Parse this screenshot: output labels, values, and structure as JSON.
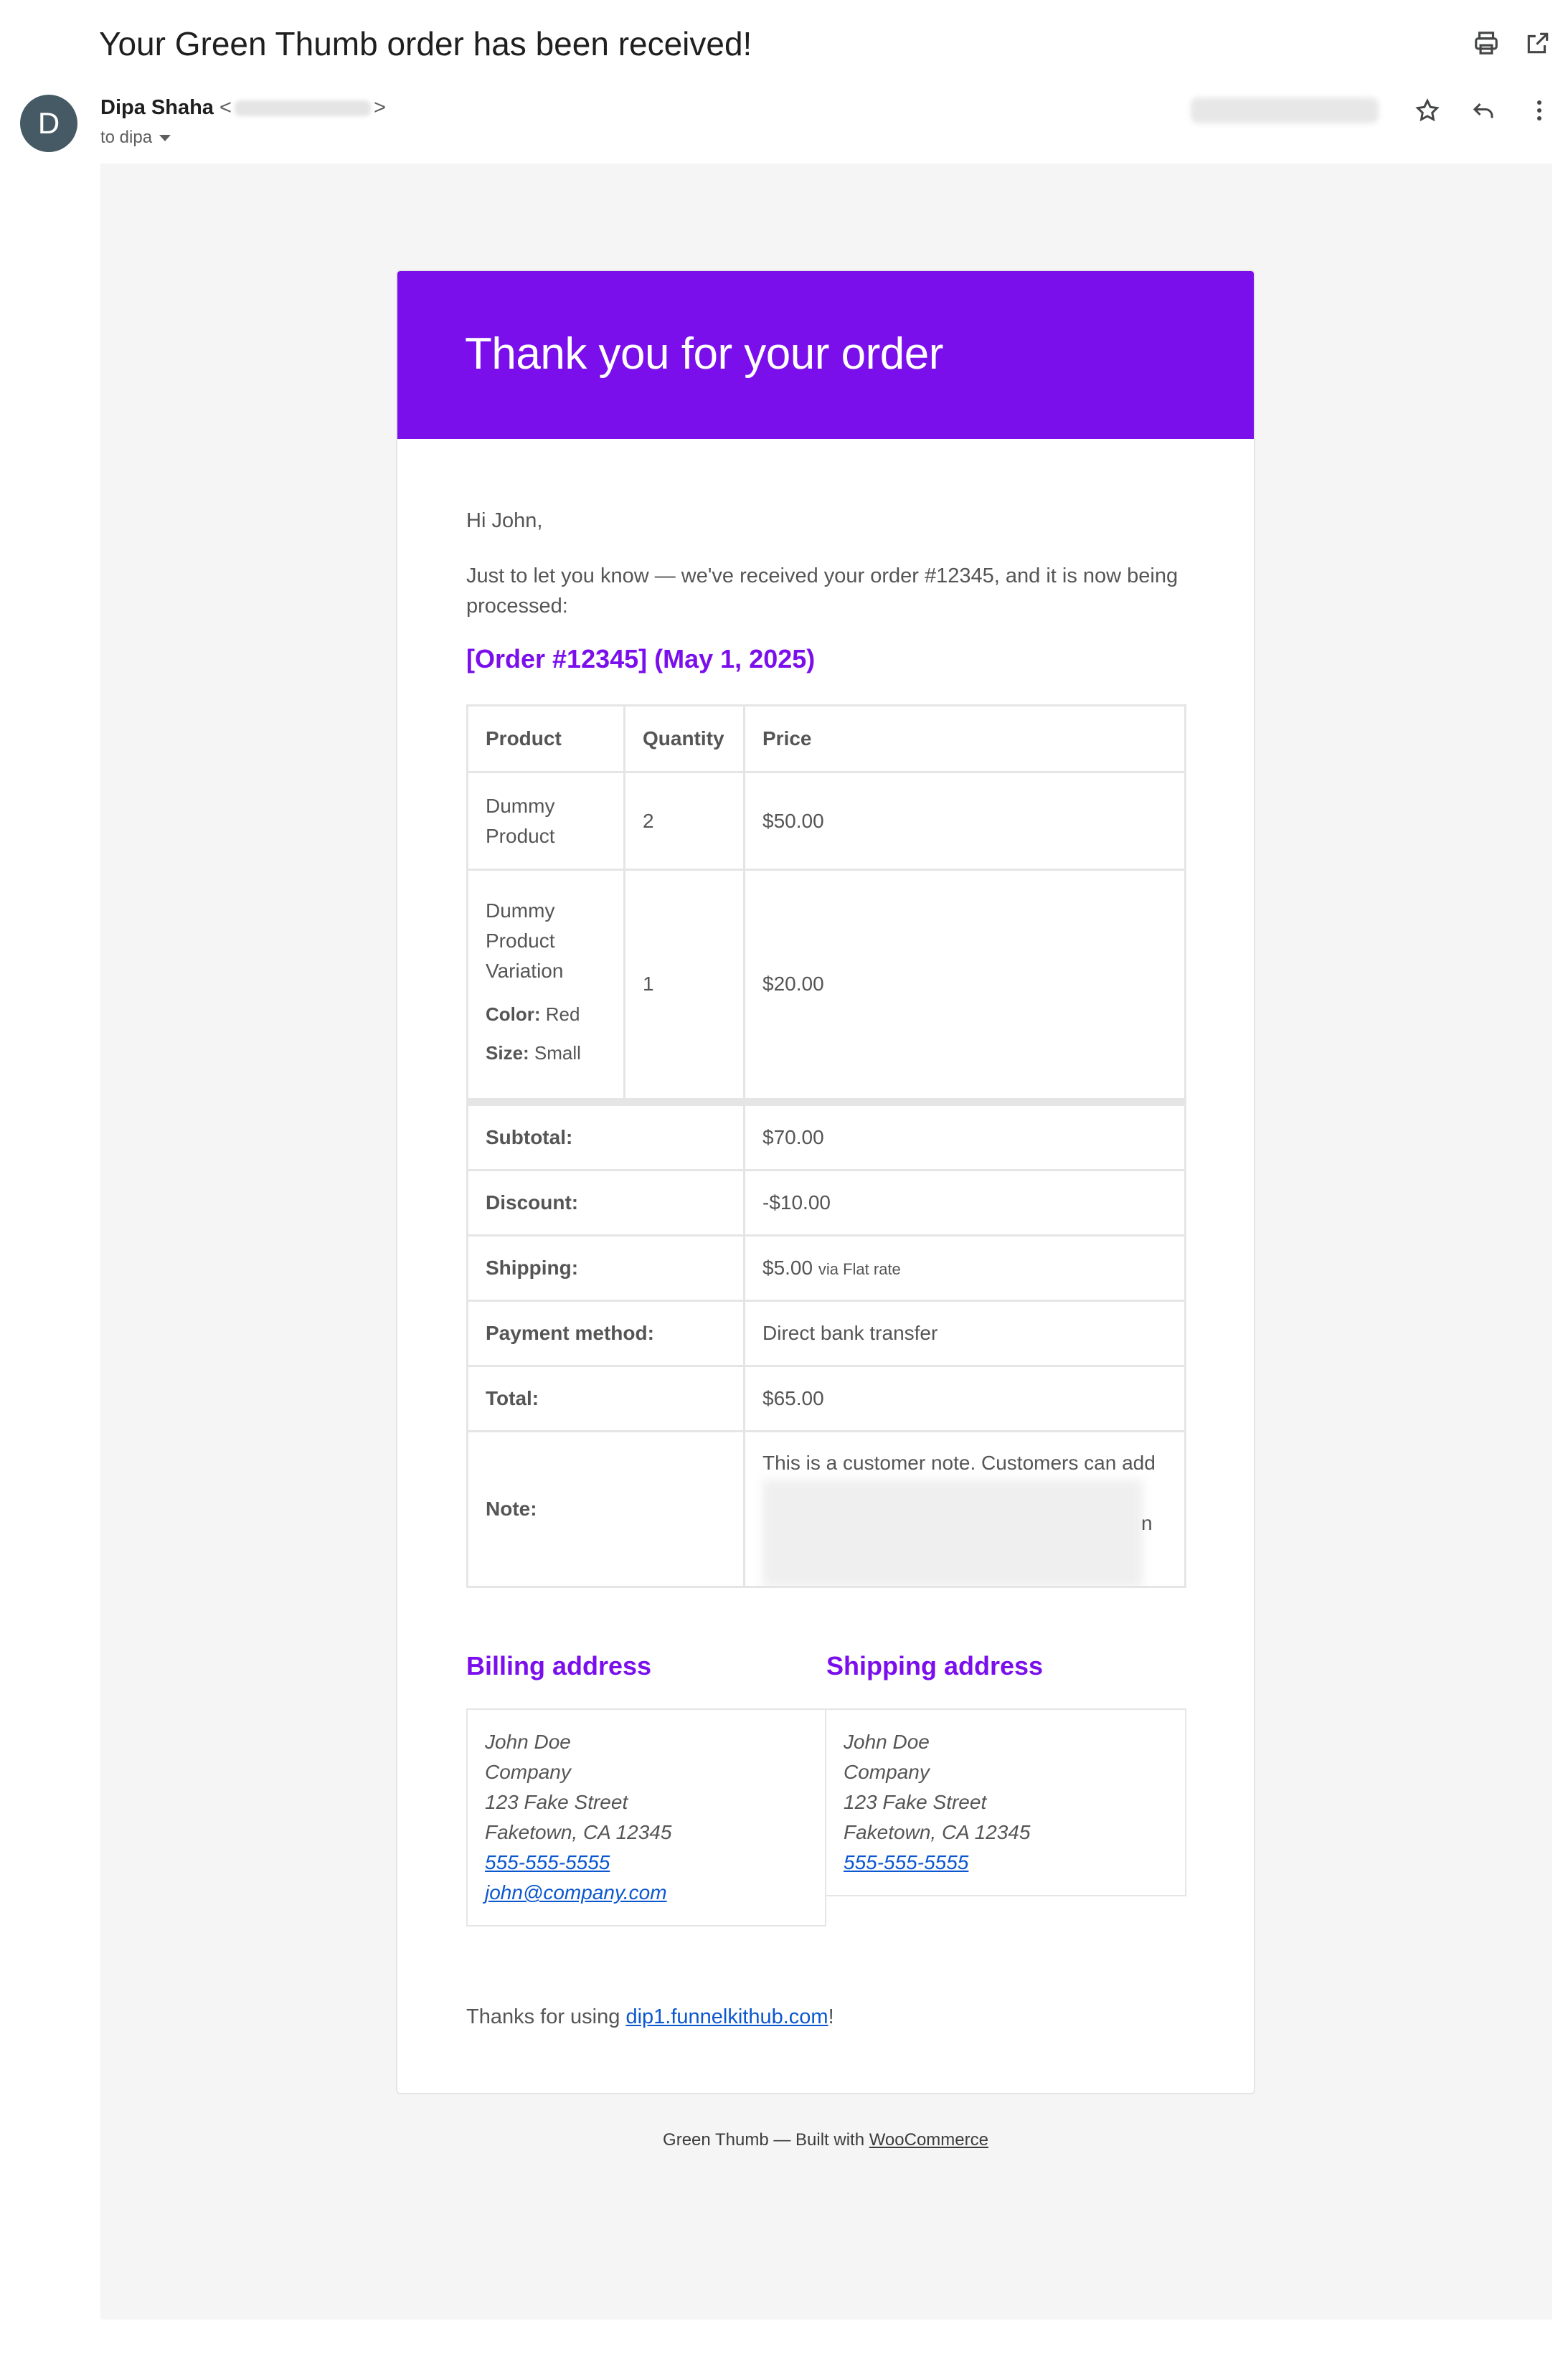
{
  "mail": {
    "subject": "Your Green Thumb order has been received!",
    "avatar_letter": "D",
    "sender_name": "Dipa Shaha",
    "sender_open": "<",
    "sender_close": ">",
    "to_label": "to dipa"
  },
  "email": {
    "header_title": "Thank you for your order",
    "greeting": "Hi John,",
    "intro": "Just to let you know — we've received your order #12345, and it is now being processed:",
    "order_title": "[Order #12345] (May 1, 2025)",
    "table": {
      "headers": [
        "Product",
        "Quantity",
        "Price"
      ],
      "items": [
        {
          "name": "Dummy Product",
          "qty": "2",
          "price": "$50.00"
        },
        {
          "name": "Dummy Product Variation",
          "qty": "1",
          "price": "$20.00",
          "meta": [
            {
              "key": "Color:",
              "value": "Red"
            },
            {
              "key": "Size:",
              "value": "Small"
            }
          ]
        }
      ],
      "totals": [
        {
          "label": "Subtotal:",
          "value": "$70.00"
        },
        {
          "label": "Discount:",
          "value": "-$10.00"
        },
        {
          "label": "Shipping:",
          "value": "$5.00",
          "extra": "via Flat rate"
        },
        {
          "label": "Payment method:",
          "value": "Direct bank transfer"
        },
        {
          "label": "Total:",
          "value": "$65.00"
        }
      ],
      "note_label": "Note:",
      "note_text": "This is a customer note. Customers can add",
      "note_trail": "n"
    },
    "billing": {
      "title": "Billing address",
      "lines": [
        "John Doe",
        "Company",
        "123 Fake Street",
        "Faketown, CA 12345"
      ],
      "phone": "555-555-5555",
      "email": "john@company.com"
    },
    "shipping": {
      "title": "Shipping address",
      "lines": [
        "John Doe",
        "Company",
        "123 Fake Street",
        "Faketown, CA 12345"
      ],
      "phone": "555-555-5555"
    },
    "thanks_prefix": "Thanks for using ",
    "thanks_link": "dip1.funnelkithub.com",
    "thanks_suffix": "!",
    "footer_prefix": "Green Thumb — Built with ",
    "footer_link": "WooCommerce",
    "accent_color": "#7a0fec"
  }
}
